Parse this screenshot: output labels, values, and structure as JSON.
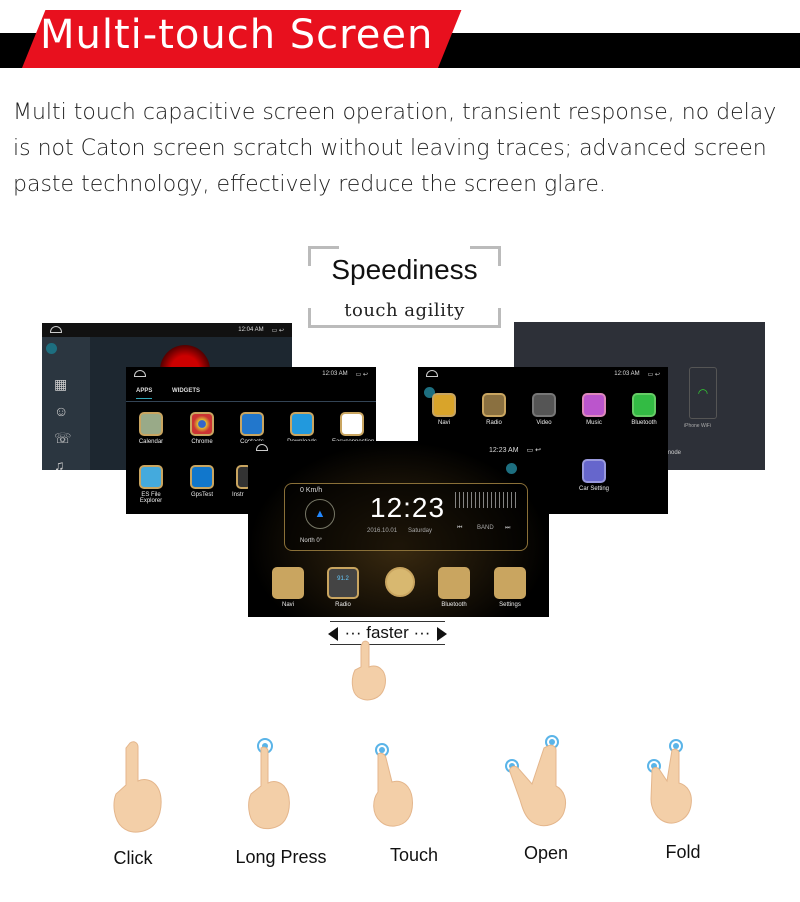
{
  "header": {
    "title": "Multi-touch Screen",
    "accent": "#e8101e"
  },
  "description": "Multi touch capacitive screen operation, transient response, no delay is not Caton screen scratch without leaving traces; advanced screen paste technology, effectively reduce the screen glare.",
  "speediness": {
    "title": "Speediness",
    "subtitle": "touch  agility"
  },
  "screens": {
    "phone": {
      "time": "12:04 AM"
    },
    "apps": {
      "time": "12:03 AM",
      "tabs": [
        "APPS",
        "WIDGETS"
      ],
      "apps": [
        "Calendar",
        "Chrome",
        "Contacts",
        "Downloads",
        "Easyconnection",
        "ES File Explorer",
        "GpsTest",
        "Instr"
      ]
    },
    "launcher": {
      "time": "12:03 AM",
      "apps": [
        "Navi",
        "Radio",
        "Video",
        "Music",
        "Bluetooth",
        "Car Setting"
      ]
    },
    "carplay": {
      "wifi_label": "iPhone WiFi",
      "mode_label": "mode"
    },
    "home": {
      "time": "12:23 AM",
      "speed": "0 Km/h",
      "clock": "12:23",
      "date": "2016.10.01",
      "weekday": "Saturday",
      "heading": "North 0°",
      "band": "BAND",
      "radio_freq": "91.2",
      "dock": [
        "Navi",
        "Radio",
        "Bluetooth",
        "Settings"
      ]
    }
  },
  "faster_label": "faster",
  "gestures": [
    "Click",
    "Long Press",
    "Touch",
    "Open",
    "Fold"
  ]
}
